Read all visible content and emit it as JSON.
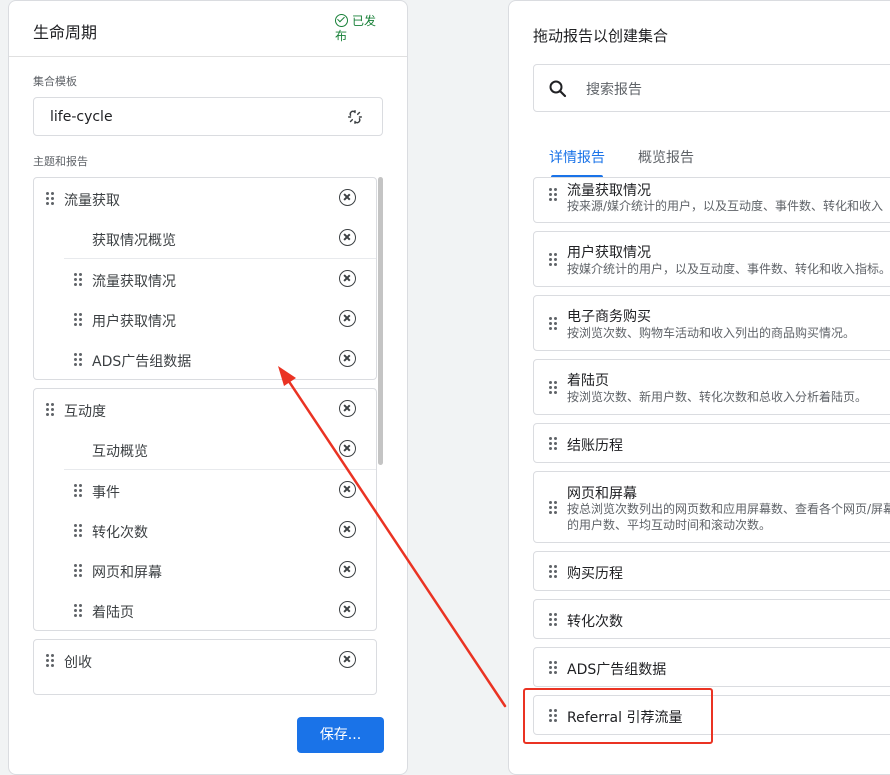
{
  "left_panel": {
    "title": "生命周期",
    "status": "已发布",
    "template_label": "集合模板",
    "template_value": "life-cycle",
    "topics_label": "主题和报告",
    "groups": [
      {
        "topic": "流量获取",
        "reports": [
          "获取情况概览",
          "流量获取情况",
          "用户获取情况",
          "ADS广告组数据"
        ]
      },
      {
        "topic": "互动度",
        "reports": [
          "互动概览",
          "事件",
          "转化次数",
          "网页和屏幕",
          "着陆页"
        ]
      },
      {
        "topic": "创收",
        "reports": []
      }
    ],
    "save_label": "保存..."
  },
  "right_panel": {
    "title": "拖动报告以创建集合",
    "search_placeholder": "搜索报告",
    "tabs": [
      {
        "label": "详情报告",
        "active": true
      },
      {
        "label": "概览报告",
        "active": false
      }
    ],
    "reports": [
      {
        "title": "流量获取情况",
        "desc": "按来源/媒介统计的用户，以及互动度、事件数、转化和收入"
      },
      {
        "title": "用户获取情况",
        "desc": "按媒介统计的用户，以及互动度、事件数、转化和收入指标。"
      },
      {
        "title": "电子商务购买",
        "desc": "按浏览次数、购物车活动和收入列出的商品购买情况。"
      },
      {
        "title": "着陆页",
        "desc": "按浏览次数、新用户数、转化次数和总收入分析着陆页。"
      },
      {
        "title": "结账历程",
        "desc": ""
      },
      {
        "title": "网页和屏幕",
        "desc": "按总浏览次数列出的网页数和应用屏幕数、查看各个网页/屏幕的用户数、平均互动时间和滚动次数。"
      },
      {
        "title": "购买历程",
        "desc": ""
      },
      {
        "title": "转化次数",
        "desc": ""
      },
      {
        "title": "ADS广告组数据",
        "desc": ""
      },
      {
        "title": "Referral 引荐流量",
        "desc": ""
      }
    ]
  },
  "annotation": {
    "color": "#ea3323"
  },
  "icons": [
    "check-circle-icon",
    "unlink-icon",
    "drag-handle-icon",
    "remove-circle-icon",
    "search-icon",
    "arrow-icon"
  ]
}
